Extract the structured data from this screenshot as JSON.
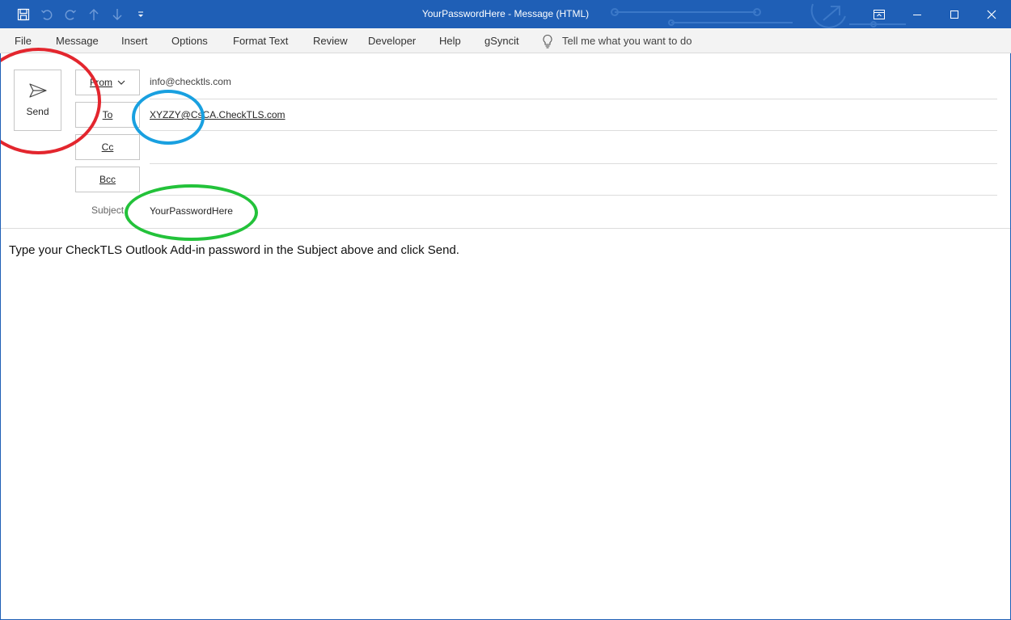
{
  "window": {
    "title": "YourPasswordHere  -  Message (HTML)",
    "titlebar_color": "#1f5fb6",
    "controls": [
      "ribbon-display-options-icon",
      "minimize-icon",
      "maximize-icon",
      "close-icon"
    ]
  },
  "quick_access": [
    "save-icon",
    "undo-icon",
    "redo-icon",
    "previous-item-icon",
    "next-item-icon",
    "customize-qat-icon"
  ],
  "menu": {
    "tabs": [
      "File",
      "Message",
      "Insert",
      "Options",
      "Format Text",
      "Review",
      "Developer",
      "Help",
      "gSyncit"
    ],
    "tell_me": "Tell me what you want to do"
  },
  "compose": {
    "send_label": "Send",
    "from_label": "From",
    "from_value": "info@checktls.com",
    "to_label": "To",
    "to_value": "XYZZY@CsCA.CheckTLS.com",
    "cc_label": "Cc",
    "bcc_label": "Bcc",
    "subject_label": "Subject",
    "subject_value": "YourPasswordHere"
  },
  "message_body": "Type your CheckTLS Outlook Add-in password in the Subject above and click Send.",
  "annotations": {
    "send_circle_color": "#e3262e",
    "to_circle_color": "#19a0e0",
    "subject_circle_color": "#23c23a"
  }
}
